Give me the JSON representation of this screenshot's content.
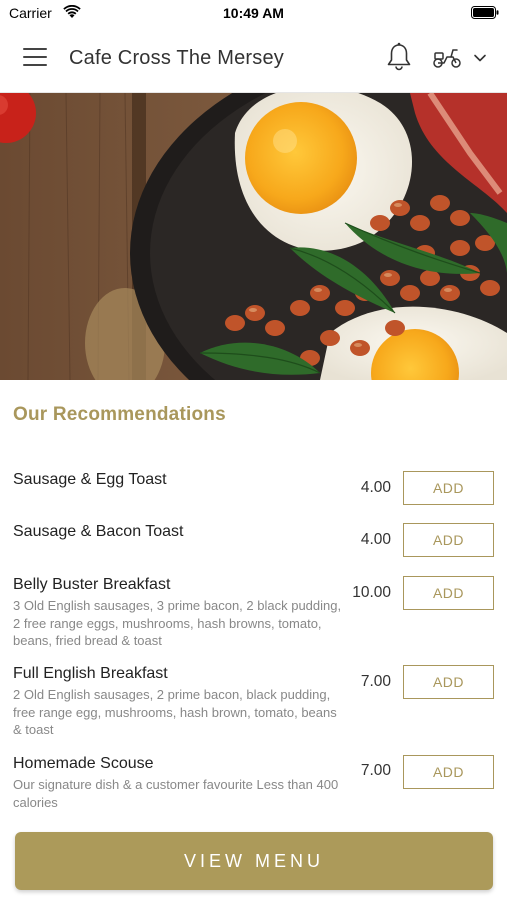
{
  "status_bar": {
    "carrier": "Carrier",
    "time": "10:49 AM"
  },
  "header": {
    "title": "Cafe Cross The Mersey",
    "icons": [
      "menu-icon",
      "bell-icon",
      "scooter-icon",
      "chevron-down-icon"
    ]
  },
  "hero": {
    "image": "full-english-breakfast-pan-photo"
  },
  "section": {
    "title": "Our Recommendations"
  },
  "items": [
    {
      "name": "Sausage & Egg Toast",
      "description": "",
      "price": "4.00",
      "add_label": "ADD"
    },
    {
      "name": "Sausage & Bacon Toast",
      "description": "",
      "price": "4.00",
      "add_label": "ADD"
    },
    {
      "name": "Belly Buster Breakfast",
      "description": "3 Old English sausages, 3 prime bacon, 2 black pudding, 2 free range eggs, mushrooms, hash browns, tomato, beans, fried bread & toast",
      "price": "10.00",
      "add_label": "ADD"
    },
    {
      "name": "Full English Breakfast",
      "description": "2 Old English sausages, 2 prime bacon, black pudding, free range egg, mushrooms, hash brown, tomato, beans & toast",
      "price": "7.00",
      "add_label": "ADD"
    },
    {
      "name": "Homemade Scouse",
      "description": "Our signature dish & a customer favourite  Less than 400 calories",
      "price": "7.00",
      "add_label": "ADD"
    }
  ],
  "footer": {
    "view_menu_label": "VIEW MENU"
  },
  "colors": {
    "accent": "#a9975c",
    "button_fill": "#ac9a5a",
    "text": "#222222",
    "muted": "#888888"
  }
}
